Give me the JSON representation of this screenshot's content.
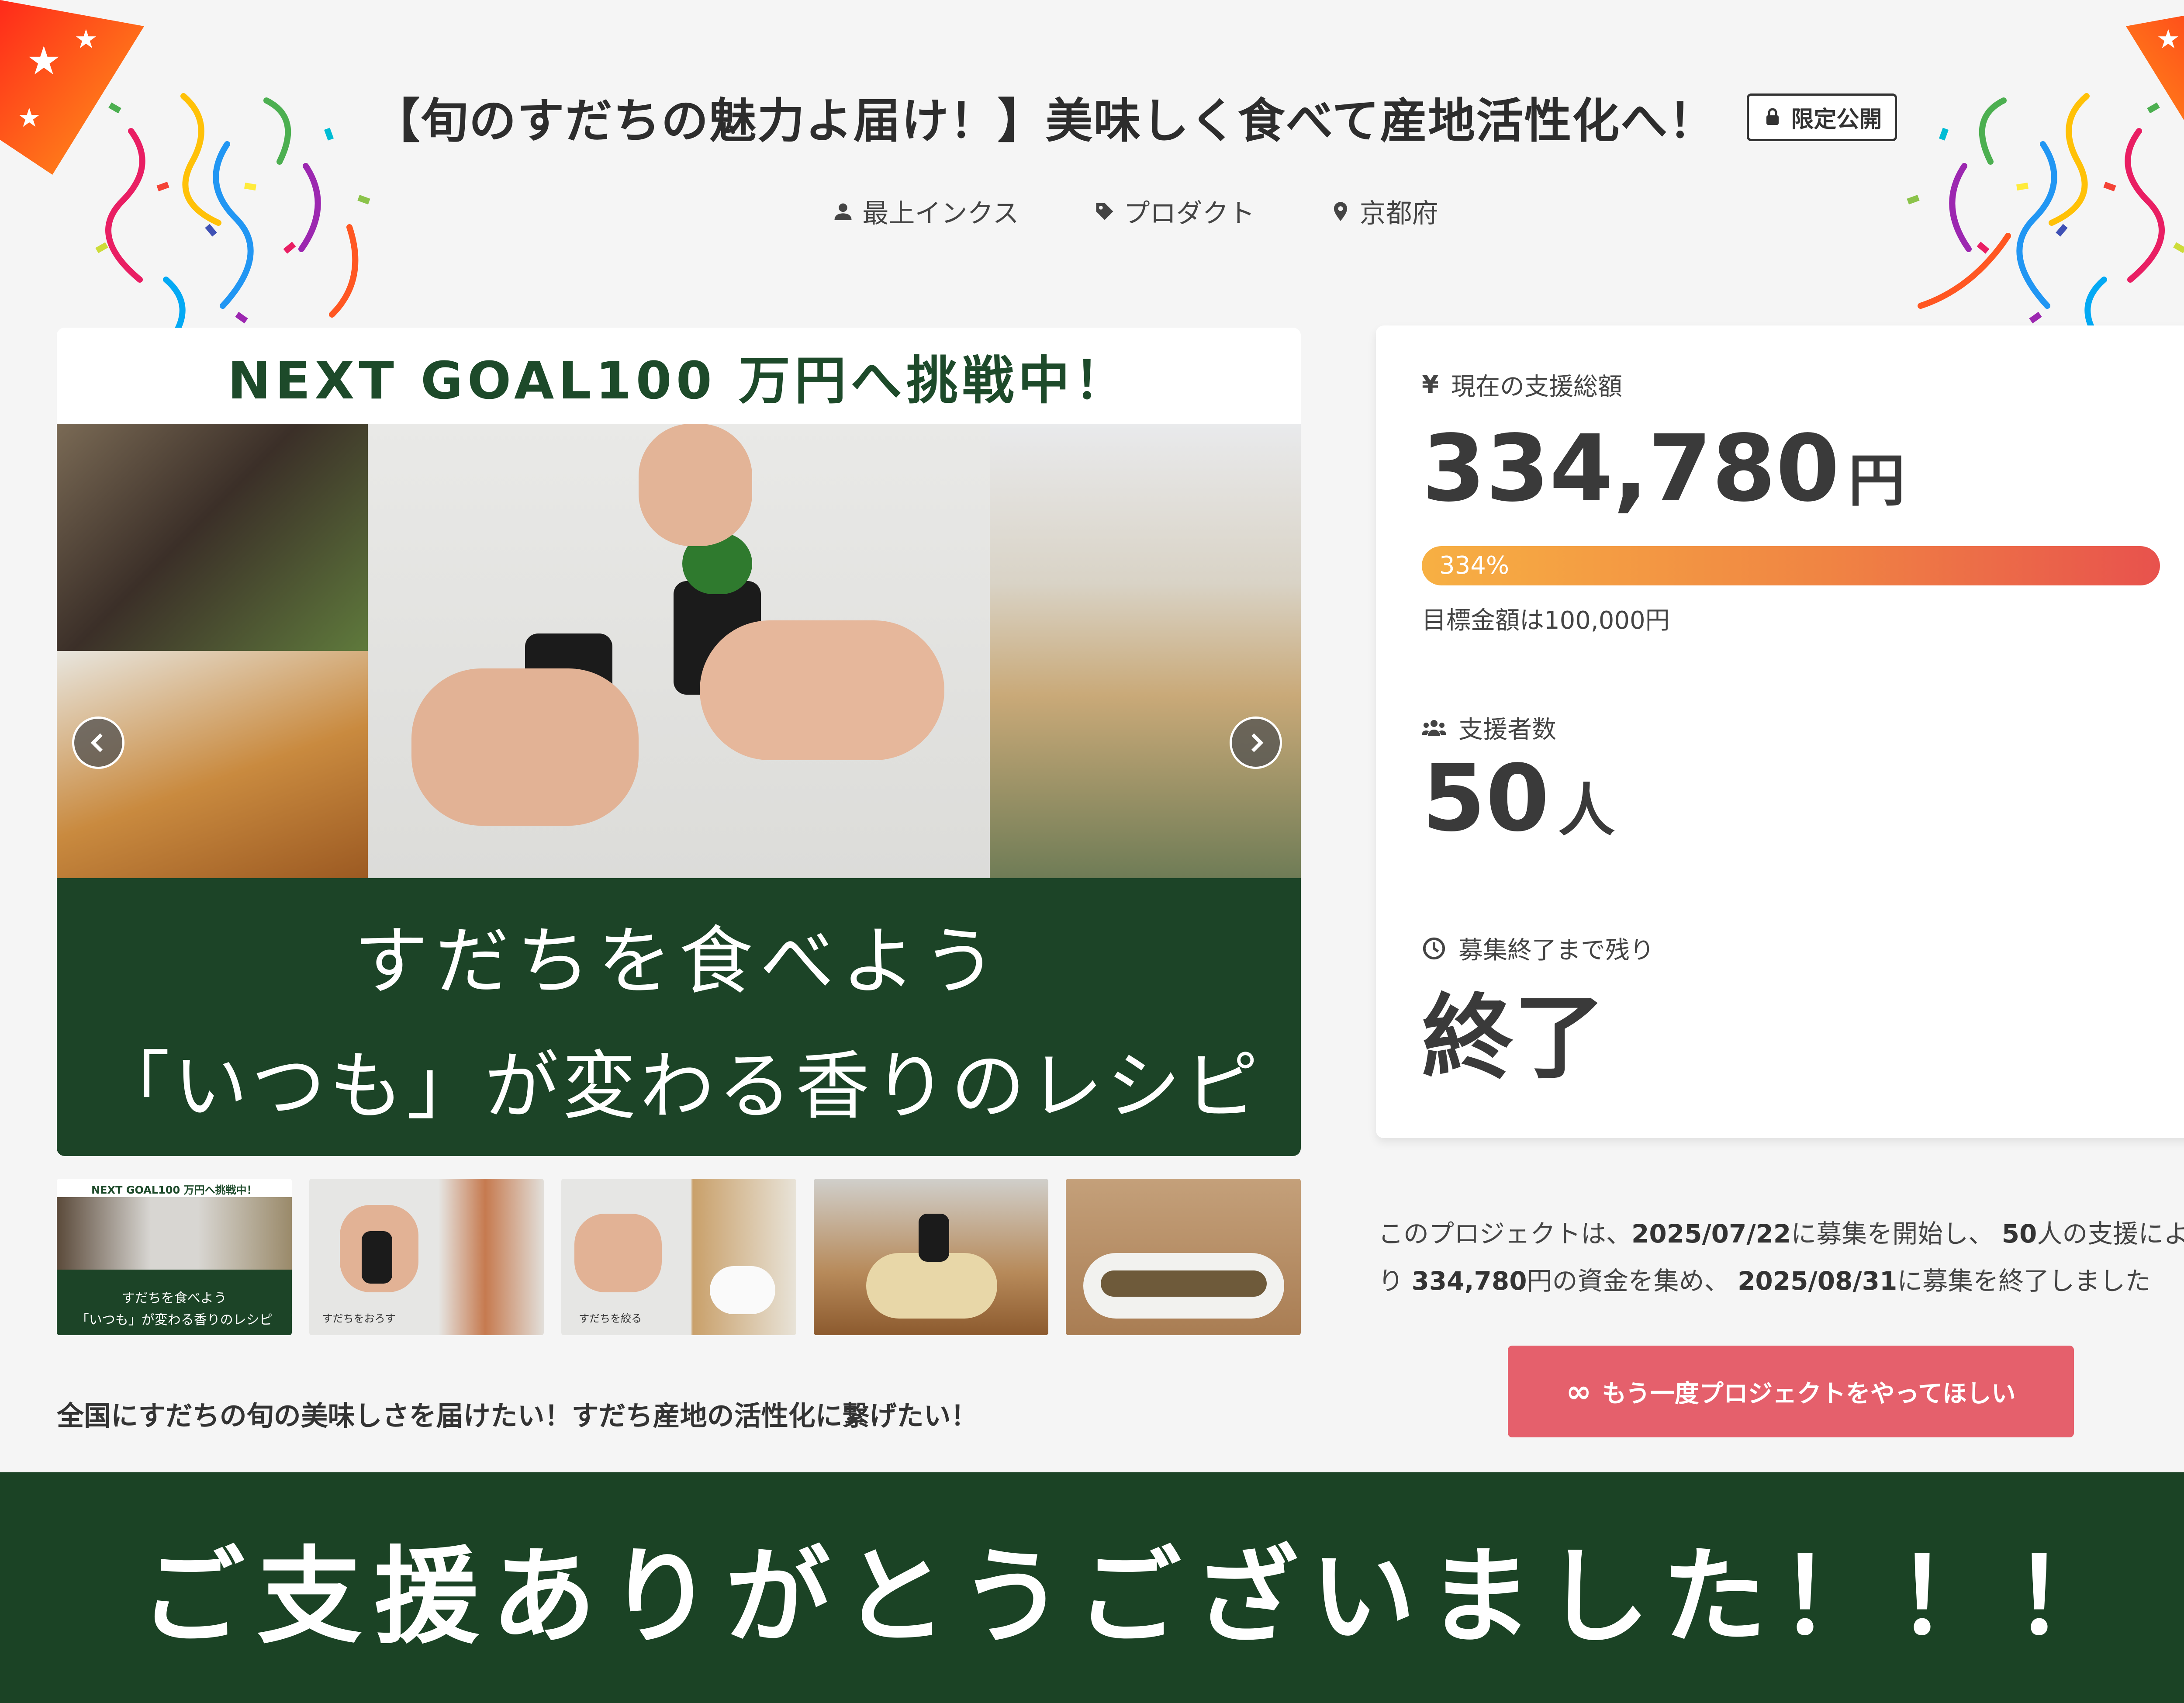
{
  "project": {
    "title": "【旬のすだちの魅力よ届け！】美味しく食べて産地活性化へ！",
    "limited_label": "限定公開",
    "owner": "最上インクス",
    "category": "プロダクト",
    "location": "京都府"
  },
  "main_image": {
    "next_goal": "NEXT GOAL100 万円へ挑戦中！",
    "headline_line1": "すだちを食べよう",
    "headline_line2": "「いつも」が変わる香りのレシピ",
    "icons": {
      "prev": "chevron-left-icon",
      "next": "chevron-right-icon"
    }
  },
  "thumbnails": [
    {
      "caption_top": "NEXT GOAL100 万円へ挑戦中！",
      "caption_bottom_1": "すだちを食べよう",
      "caption_bottom_2": "「いつも」が変わる香りのレシピ"
    },
    {
      "caption": "すだちをおろす"
    },
    {
      "caption": "すだちを絞る"
    },
    {
      "caption": ""
    },
    {
      "caption": ""
    }
  ],
  "lead_text": "全国にすだちの旬の美味しさを届けたい！すだち産地の活性化に繋げたい！",
  "stats": {
    "total_label": "現在の支援総額",
    "total_value": "334,780",
    "total_unit": "円",
    "progress_label": "334%",
    "progress_percent": 334,
    "goal_text": "目標金額は100,000円",
    "supporters_label": "支援者数",
    "supporters_value": "50",
    "supporters_unit": "人",
    "remaining_label": "募集終了まで残り",
    "remaining_value": "終了"
  },
  "summary": {
    "part1": "このプロジェクトは、",
    "start_date": "2025/07/22",
    "part2": "に募集を開始し、",
    "supporters": "50",
    "part3": "人の支援により",
    "amount": "334,780",
    "part4": "円の資金を集め、",
    "end_date": "2025/08/31",
    "part5": "に募集を終了しました"
  },
  "again_button": {
    "label": "もう一度プロジェクトをやってほしい",
    "icon": "infinity-icon"
  },
  "thanks_banner": "ご支援ありがとうございました！！！",
  "colors": {
    "background": "#f5f5f5",
    "dark_green": "#1c4427",
    "progress_start": "#f7b043",
    "progress_end": "#e8524d",
    "button": "#e5606c"
  }
}
